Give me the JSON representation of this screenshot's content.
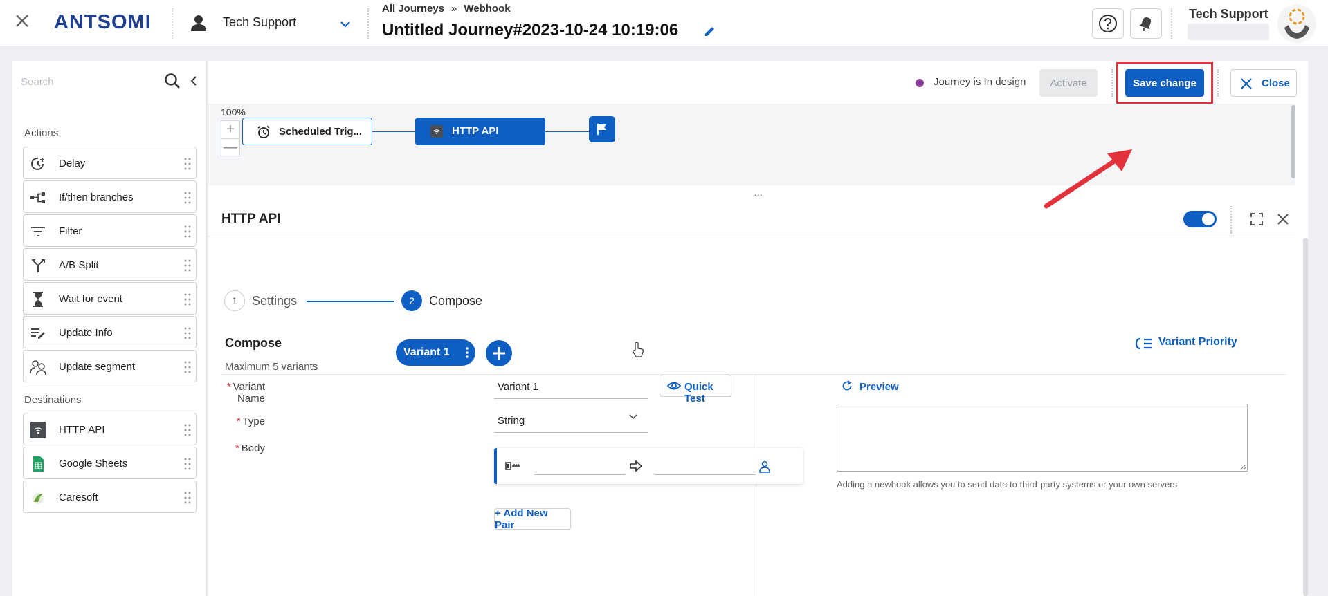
{
  "header": {
    "logo": "ANTSOMI",
    "account_name": "Tech Support",
    "breadcrumb": [
      "All Journeys",
      "Webhook"
    ],
    "breadcrumb_sep": "»",
    "journey_title": "Untitled Journey#2023-10-24 10:19:06",
    "user_name": "Tech Support"
  },
  "sidebar": {
    "search_placeholder": "Search",
    "actions_title": "Actions",
    "actions": [
      {
        "label": "Delay",
        "icon": "delay-icon"
      },
      {
        "label": "If/then branches",
        "icon": "branch-icon"
      },
      {
        "label": "Filter",
        "icon": "filter-icon"
      },
      {
        "label": "A/B Split",
        "icon": "split-icon"
      },
      {
        "label": "Wait for event",
        "icon": "hourglass-icon"
      },
      {
        "label": "Update Info",
        "icon": "edit-list-icon"
      },
      {
        "label": "Update segment",
        "icon": "segment-icon"
      }
    ],
    "destinations_title": "Destinations",
    "destinations": [
      {
        "label": "HTTP API",
        "icon": "wifi-icon"
      },
      {
        "label": "Google Sheets",
        "icon": "google-sheets-icon"
      },
      {
        "label": "Caresoft",
        "icon": "caresoft-icon"
      }
    ]
  },
  "toolbar": {
    "status": "Journey is In design",
    "status_color": "#8a3f98",
    "activate_label": "Activate",
    "save_label": "Save change",
    "close_label": "Close"
  },
  "canvas": {
    "zoom": "100%",
    "zoom_in": "+",
    "zoom_out": "—",
    "nodes": [
      {
        "label": "Scheduled Trig..."
      },
      {
        "label": "HTTP API"
      }
    ],
    "divider_dots": "..."
  },
  "panel": {
    "title": "HTTP API",
    "enabled": true,
    "steps": [
      {
        "number": "1",
        "label": "Settings"
      },
      {
        "number": "2",
        "label": "Compose"
      }
    ],
    "compose_title": "Compose",
    "compose_sub": "Maximum 5 variants",
    "variant_label": "Variant 1",
    "variant_priority": "Variant Priority",
    "fields": {
      "variant_name_label": "Variant Name",
      "variant_name_value": "Variant 1",
      "type_label": "Type",
      "type_value": "String",
      "body_label": "Body",
      "required_mark": "*"
    },
    "quick_test": "Quick Test",
    "add_pair": "+ Add New Pair",
    "preview_label": "Preview",
    "preview_note": "Adding a newhook allows you to send data to third-party systems or your own servers"
  },
  "colors": {
    "primary": "#0f5fc2",
    "highlight": "#e2333c"
  }
}
